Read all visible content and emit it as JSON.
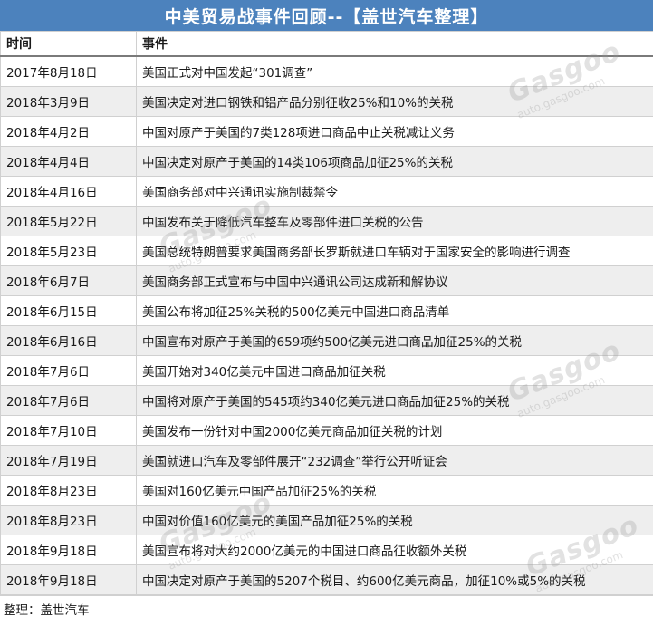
{
  "title": "中美贸易战事件回顾--【盖世汽车整理】",
  "table": {
    "headers": [
      "时间",
      "事件"
    ],
    "rows": [
      {
        "date": "2017年8月18日",
        "event": "美国正式对中国发起“301调查”"
      },
      {
        "date": "2018年3月9日",
        "event": "美国决定对进口钢铁和铝产品分别征收25%和10%的关税"
      },
      {
        "date": "2018年4月2日",
        "event": "中国对原产于美国的7类128项进口商品中止关税减让义务"
      },
      {
        "date": "2018年4月4日",
        "event": "中国决定对原产于美国的14类106项商品加征25%的关税"
      },
      {
        "date": "2018年4月16日",
        "event": "美国商务部对中兴通讯实施制裁禁令"
      },
      {
        "date": "2018年5月22日",
        "event": "中国发布关于降低汽车整车及零部件进口关税的公告"
      },
      {
        "date": "2018年5月23日",
        "event": "美国总统特朗普要求美国商务部长罗斯就进口车辆对于国家安全的影响进行调查"
      },
      {
        "date": "2018年6月7日",
        "event": "美国商务部正式宣布与中国中兴通讯公司达成新和解协议"
      },
      {
        "date": "2018年6月15日",
        "event": "美国公布将加征25%关税的500亿美元中国进口商品清单"
      },
      {
        "date": "2018年6月16日",
        "event": "中国宣布对原产于美国的659项约500亿美元进口商品加征25%的关税"
      },
      {
        "date": "2018年7月6日",
        "event": "美国开始对340亿美元中国进口商品加征关税"
      },
      {
        "date": "2018年7月6日",
        "event": "中国将对原产于美国的545项约340亿美元进口商品加征25%的关税"
      },
      {
        "date": "2018年7月10日",
        "event": "美国发布一份针对中国2000亿美元商品加征关税的计划"
      },
      {
        "date": "2018年7月19日",
        "event": "美国就进口汽车及零部件展开“232调查”举行公开听证会"
      },
      {
        "date": "2018年8月23日",
        "event": "美国对160亿美元中国产品加征25%的关税"
      },
      {
        "date": "2018年8月23日",
        "event": "中国对价值160亿美元的美国产品加征25%的关税"
      },
      {
        "date": "2018年9月18日",
        "event": "美国宣布将对大约2000亿美元的中国进口商品征收额外关税"
      },
      {
        "date": "2018年9月18日",
        "event": "中国决定对原产于美国的5207个税目、约600亿美元商品，加征10%或5%的关税"
      }
    ]
  },
  "footer": "整理：盖世汽车",
  "watermark": {
    "brand": "Gasgoo",
    "url": "auto.gasgoo.com"
  },
  "colors": {
    "title_bg": "#4c82bd",
    "row_alt": "#eeeeee"
  }
}
